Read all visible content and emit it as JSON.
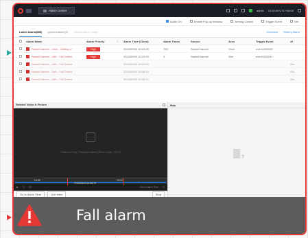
{
  "app": {
    "tab_label": "Alarm Center",
    "user": "admin",
    "clock": "15:10:09 UTC+08:00"
  },
  "toolbar": {
    "audio_on": "Audio On",
    "enable_popup": "Enable Pop-up Window",
    "arming_control": "Arming Control",
    "trigger_event": "Trigger Event",
    "set": "Set"
  },
  "tabs": {
    "latest": "Latest Alarm(885)",
    "ignored": "Ignored Alarm(0)",
    "search": "Search Alarm Image",
    "overview": "Overview",
    "history": "History Alarm"
  },
  "table": {
    "headers": [
      "Alarm Name",
      "Alarm Priority",
      "Alarm Time (Client)",
      "Alarm Times",
      "Source",
      "Area",
      "Trigger Event",
      "Al"
    ],
    "rows": [
      {
        "name": "RadarChannel - Vncli - Getting U",
        "priority": "High",
        "time": "2023/09/03 15:10:28",
        "times": "783",
        "source": "RadarChannel",
        "area": "Vncli",
        "trigger": "event-000049",
        "sub": false
      },
      {
        "name": "RadarChannel - 2lsh - Fall Detect",
        "priority": "High",
        "time": "2023/09/03 15:10:09",
        "times": "5",
        "source": "RadarChannel",
        "area": "2lsh",
        "trigger": "event-000041",
        "sub": false
      },
      {
        "name": "RadarChannel - 2lsh - Fall Detect",
        "priority": "",
        "time": "2023/09/03 15:10:09",
        "times": "",
        "source": "",
        "area": "",
        "trigger": "",
        "extra": "Sto",
        "sub": true
      },
      {
        "name": "RadarChannel - 2lsh - Fall Detect",
        "priority": "",
        "time": "2023/09/03 15:06:20",
        "times": "",
        "source": "",
        "area": "",
        "trigger": "",
        "extra": "Sto",
        "sub": true
      },
      {
        "name": "RadarChannel - 2lsh - Fall Detect",
        "priority": "",
        "time": "2023/09/03 15:05:12",
        "times": "",
        "source": "",
        "area": "",
        "trigger": "",
        "extra": "Sto",
        "sub": true
      }
    ]
  },
  "video_panel": {
    "title": "Related Video & Picture",
    "message": "Failed to Play: Playback failed (Error Code: 2010)",
    "timeline_time": "2023/09/03 14:58:15",
    "tl_left": "14:55",
    "tl_right": "15:00",
    "ctrl_left": "1X",
    "ctrl_right": "Go to Alarm Time",
    "go_to_alarm": "Go to Alarm Time",
    "live_view": "Live View",
    "stop": "Stop"
  },
  "map_panel": {
    "title": "Map"
  },
  "overlay": {
    "alarm_text": "Fall alarm"
  },
  "colors": {
    "accent": "#3c8dde",
    "alarm_red": "#e53935",
    "frame_red": "#e53935",
    "teal_arrow": "#2aa5a0"
  }
}
